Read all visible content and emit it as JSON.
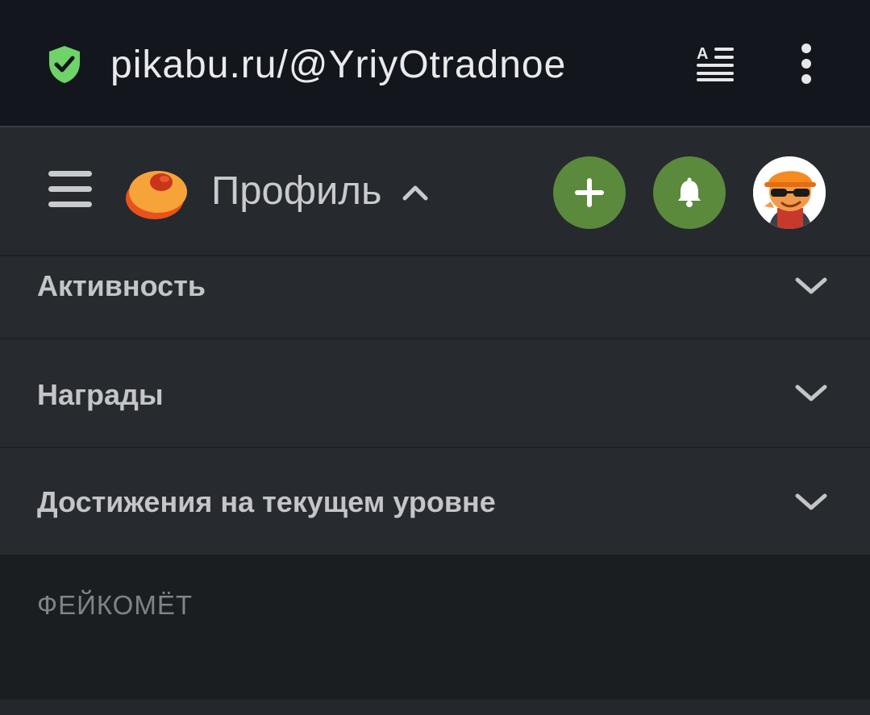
{
  "browser": {
    "url": "pikabu.ru/@YriyOtradnoe",
    "icons": {
      "security": "shield-check-icon",
      "reader_mode": "reader-mode-icon",
      "menu": "more-vertical-icon"
    },
    "colors": {
      "shield": "#6fd36a",
      "bar_bg": "#13161c"
    }
  },
  "header": {
    "title": "Профиль",
    "icons": {
      "menu": "hamburger-icon",
      "logo": "pikabu-logo",
      "title_toggle": "chevron-up-icon",
      "add": "plus-icon",
      "notifications": "bell-icon",
      "avatar": "user-avatar"
    },
    "colors": {
      "action_button": "#5b8a3c",
      "header_bg": "#26292e"
    }
  },
  "sections": [
    {
      "label": "Активность",
      "icon": "chevron-down-icon"
    },
    {
      "label": "Награды",
      "icon": "chevron-down-icon"
    },
    {
      "label": "Достижения на текущем уровне",
      "icon": "chevron-down-icon"
    }
  ],
  "card": {
    "title": "ФЕЙКОМЁТ"
  }
}
